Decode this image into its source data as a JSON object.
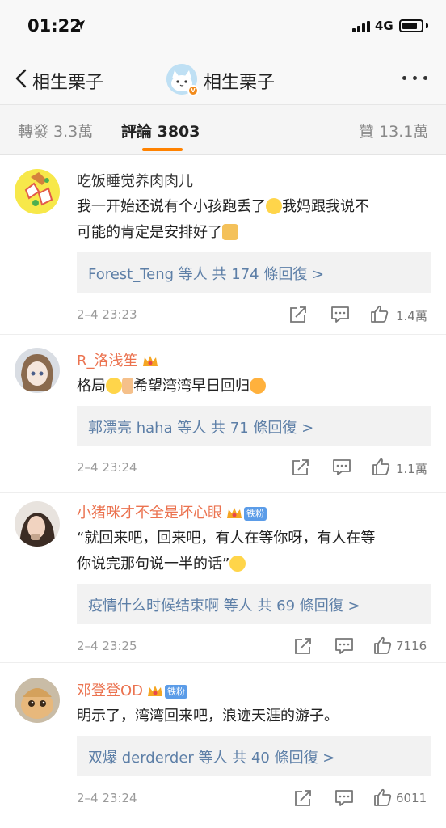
{
  "status_bar": {
    "time": "01:22",
    "network": "4G"
  },
  "nav": {
    "back_label": "相生栗子",
    "title": "相生栗子"
  },
  "tabs": {
    "repost": "轉發 3.3萬",
    "comments": "評論 3803",
    "likes": "贊 13.1萬"
  },
  "colors": {
    "accent": "#ff8200",
    "link": "#5d7fa7",
    "username_highlight": "#eb7350"
  },
  "comments": [
    {
      "user": "吃饭睡觉养肉肉儿",
      "text_1": "我一开始还说有个小孩跑丢了",
      "text_2": "我妈跟我说不",
      "text_3": "可能的肯定是安排好了",
      "reply": "Forest_Teng 等人 共 174 條回復 >",
      "time": "2–4 23:23",
      "likes": "1.4萬"
    },
    {
      "user": "R_洛浅笙",
      "text_1": "格局",
      "text_2": "希望湾湾早日回归",
      "reply": "郭漂亮 haha 等人 共 71 條回復 >",
      "time": "2–4 23:24",
      "likes": "1.1萬"
    },
    {
      "user": "小猪咪才不全是坏心眼",
      "fan_badge": "铁粉",
      "text_1": "“就回来吧，回来吧，有人在等你呀，有人在等",
      "text_2": "你说完那句说一半的话”",
      "reply": "疫情什么时候结束啊 等人 共 69 條回復 >",
      "time": "2–4 23:25",
      "likes": "7116"
    },
    {
      "user": "邓登登OD",
      "fan_badge": "铁粉",
      "text_1": "明示了，湾湾回来吧，浪迹天涯的游子。",
      "reply": "双爆 derderder 等人 共 40 條回復 >",
      "time": "2–4 23:24",
      "likes": "6011"
    }
  ]
}
